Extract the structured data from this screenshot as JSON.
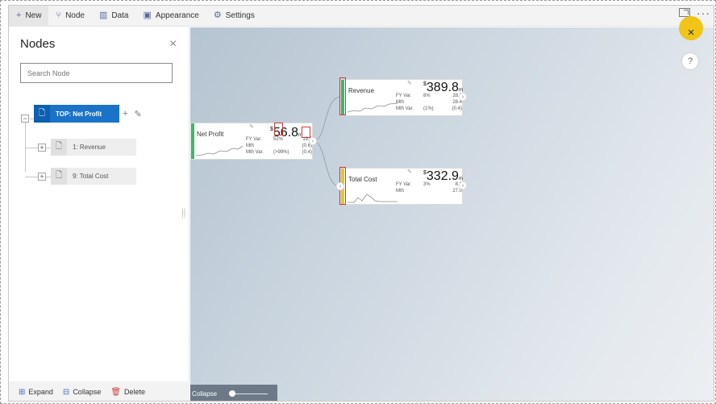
{
  "toolbar": {
    "items": [
      {
        "label": "New",
        "icon": "plus-icon"
      },
      {
        "label": "Node",
        "icon": "node-icon"
      },
      {
        "label": "Data",
        "icon": "data-icon"
      },
      {
        "label": "Appearance",
        "icon": "appearance-icon"
      },
      {
        "label": "Settings",
        "icon": "settings-icon"
      }
    ]
  },
  "panel": {
    "title": "Nodes",
    "search_placeholder": "Search Node",
    "tree": {
      "top": "TOP: Net Profit",
      "children": [
        "1: Revenue",
        "9: Total Cost"
      ]
    },
    "footer": {
      "expand": "Expand",
      "collapse": "Collapse",
      "delete": "Delete"
    }
  },
  "canvas": {
    "collapse_label": "Collapse",
    "help": "?",
    "cards": {
      "net_profit": {
        "name": "Net Profit",
        "value": "56.8",
        "currency": "$",
        "unit": "m",
        "rows": [
          [
            "FY Var.",
            "52%",
            "19.5"
          ],
          [
            "Mth",
            "",
            "(0.6)"
          ],
          [
            "Mth Var.",
            "(>99%)",
            "(0.4)"
          ]
        ],
        "color": "#3cb96a"
      },
      "revenue": {
        "name": "Revenue",
        "value": "389.8",
        "currency": "$",
        "unit": "m",
        "rows": [
          [
            "FY Var.",
            "8%",
            "28.3"
          ],
          [
            "Mth",
            "",
            "28.4"
          ],
          [
            "Mth Var.",
            "(1%)",
            "(0.4)"
          ]
        ],
        "color": "#3cb96a"
      },
      "total_cost": {
        "name": "Total Cost",
        "value": "332.9",
        "currency": "$",
        "unit": "m",
        "rows": [
          [
            "FY Var.",
            "3%",
            "8.9"
          ],
          [
            "Mth",
            "",
            "27.0"
          ]
        ],
        "color": "#f0c419"
      }
    }
  },
  "colors": {
    "accent": "#1a73c8",
    "green": "#3cb96a",
    "yellow": "#f0c419"
  }
}
